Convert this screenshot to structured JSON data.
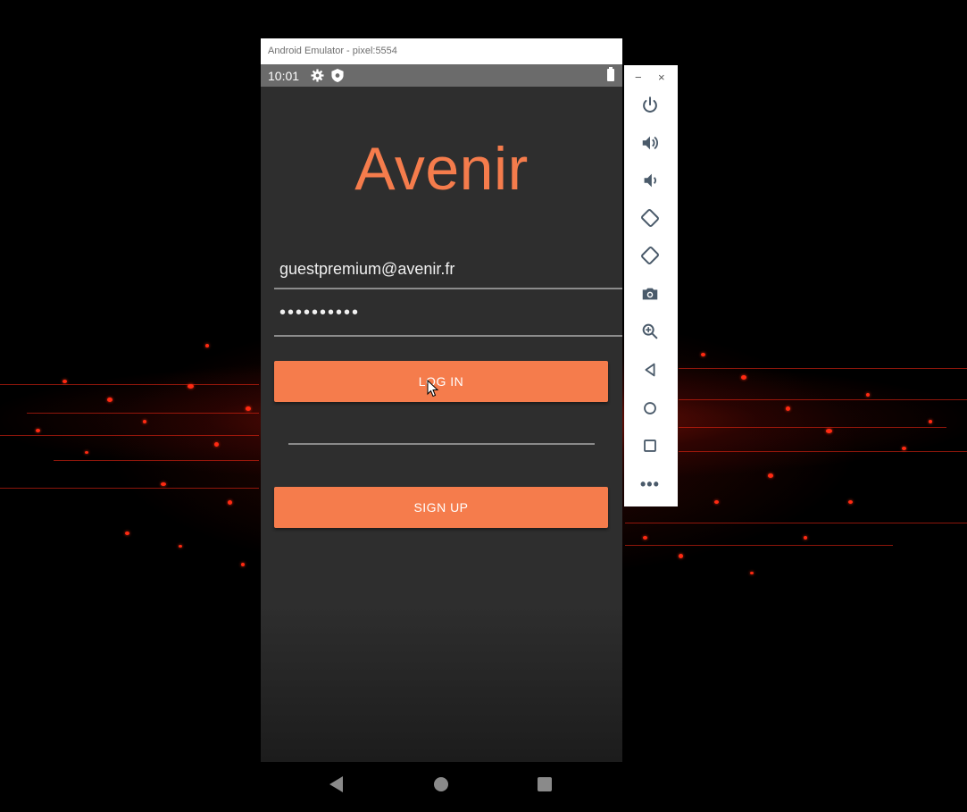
{
  "window": {
    "title": "Android Emulator - pixel:5554"
  },
  "statusbar": {
    "time": "10:01"
  },
  "app": {
    "logo": "Avenir",
    "email_value": "guestpremium@avenir.fr",
    "password_mask": "••••••••••",
    "login_label": "LOG IN",
    "signup_label": "SIGN UP"
  },
  "colors": {
    "accent": "#f57c4c",
    "app_bg": "#2e2e2e",
    "statusbar": "#6b6b6b"
  },
  "toolbar": {
    "minimize_label": "−",
    "close_label": "×",
    "more_label": "•••",
    "icons": [
      "power-icon",
      "volume-up-icon",
      "volume-down-icon",
      "rotate-left-icon",
      "rotate-right-icon",
      "camera-icon",
      "zoom-icon",
      "back-icon",
      "home-icon",
      "overview-icon"
    ]
  },
  "navbar": {
    "icons": [
      "nav-back-icon",
      "nav-home-icon",
      "nav-recents-icon"
    ]
  }
}
